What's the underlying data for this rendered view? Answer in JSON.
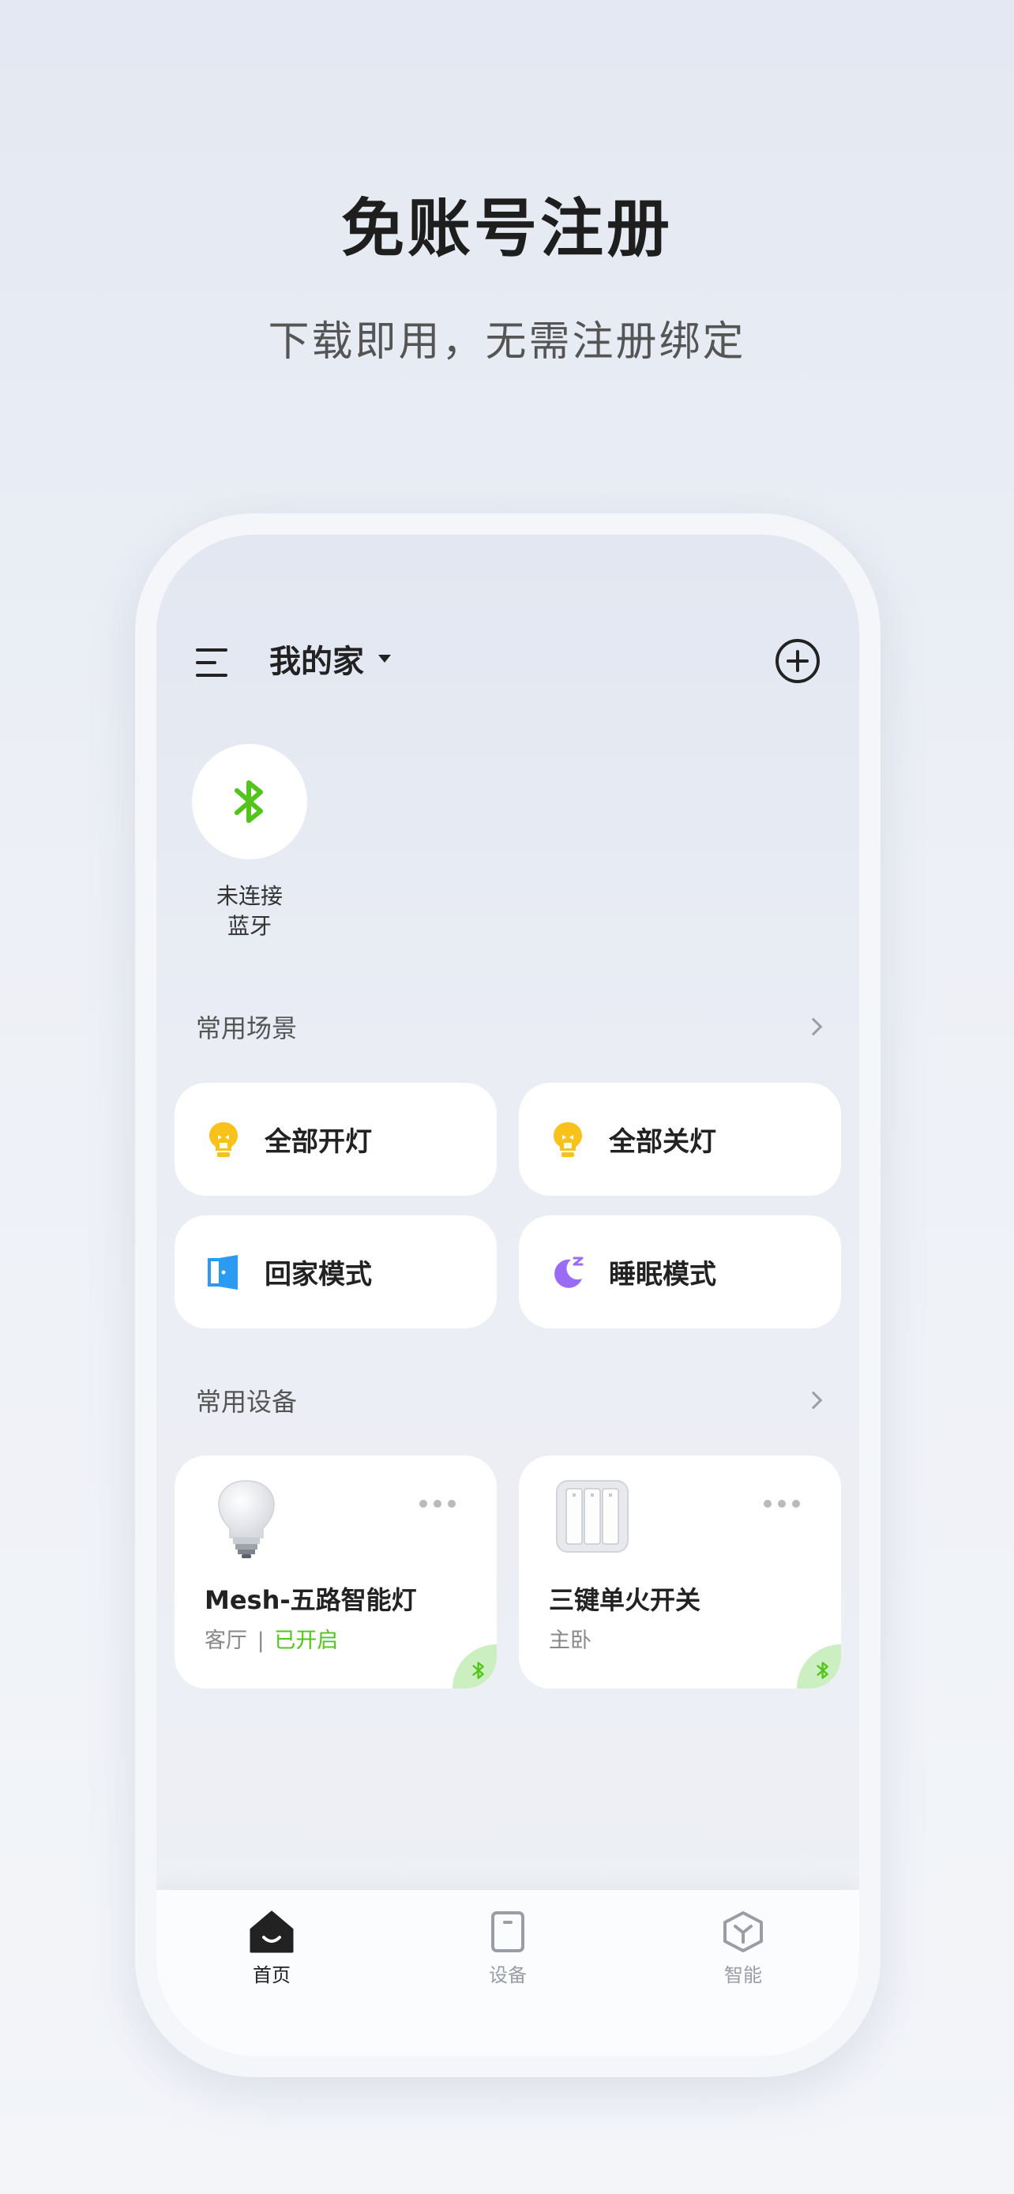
{
  "hero": {
    "title": "免账号注册",
    "subtitle": "下载即用，无需注册绑定"
  },
  "header": {
    "home_name": "我的家",
    "menu_icon": "menu-icon",
    "add_icon": "add-circle-icon"
  },
  "bluetooth": {
    "icon": "bluetooth-icon",
    "status_line1": "未连接",
    "status_line2": "蓝牙",
    "color": "#52c41a"
  },
  "scenes": {
    "title": "常用场景",
    "items": [
      {
        "label": "全部开灯",
        "icon": "lightbulb-on-icon",
        "color": "#f8c21b"
      },
      {
        "label": "全部关灯",
        "icon": "lightbulb-off-icon",
        "color": "#f8c21b"
      },
      {
        "label": "回家模式",
        "icon": "door-icon",
        "color": "#2a9af3"
      },
      {
        "label": "睡眠模式",
        "icon": "moon-icon",
        "color": "#9a6cf6"
      }
    ]
  },
  "devices": {
    "title": "常用设备",
    "items": [
      {
        "name": "Mesh-五路智能灯",
        "room": "客厅",
        "separator": "|",
        "status": "已开启",
        "icon": "light-bulb-device-icon"
      },
      {
        "name": "三键单火开关",
        "room": "主卧",
        "status": "",
        "icon": "wall-switch-device-icon"
      }
    ]
  },
  "tabbar": {
    "tabs": [
      {
        "label": "首页",
        "icon": "home-icon",
        "active": true
      },
      {
        "label": "设备",
        "icon": "device-icon",
        "active": false
      },
      {
        "label": "智能",
        "icon": "smart-cube-icon",
        "active": false
      }
    ]
  },
  "colors": {
    "accent_green": "#52c41a",
    "text_primary": "#222222",
    "text_secondary": "#888888"
  }
}
